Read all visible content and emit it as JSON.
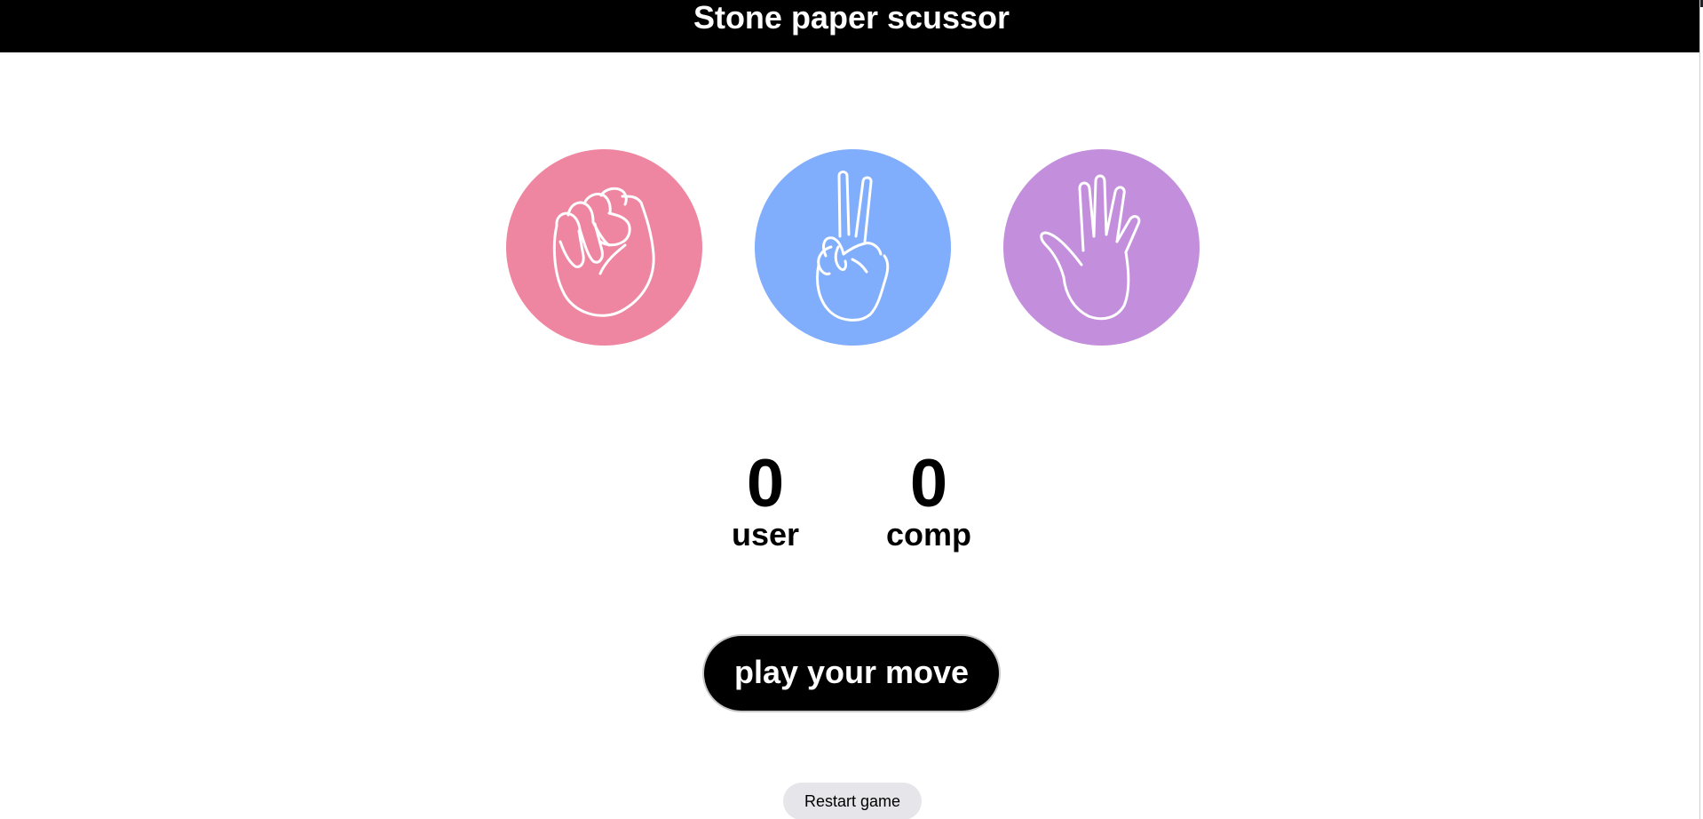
{
  "header": {
    "title": "Stone paper scussor"
  },
  "choices": [
    {
      "id": "rock",
      "icon": "fist-icon",
      "color": "#ef86a1"
    },
    {
      "id": "scissors",
      "icon": "peace-hand-icon",
      "color": "#80adfc"
    },
    {
      "id": "paper",
      "icon": "open-hand-icon",
      "color": "#c38fdc"
    }
  ],
  "scoreboard": {
    "user": {
      "score": "0",
      "label": "user"
    },
    "comp": {
      "score": "0",
      "label": "comp"
    }
  },
  "controls": {
    "play_label": "play your move",
    "restart_label": "Restart game"
  },
  "colors": {
    "header_bg": "#000000",
    "header_text": "#ffffff",
    "rock": "#ef86a1",
    "scissors": "#80adfc",
    "paper": "#c38fdc"
  }
}
